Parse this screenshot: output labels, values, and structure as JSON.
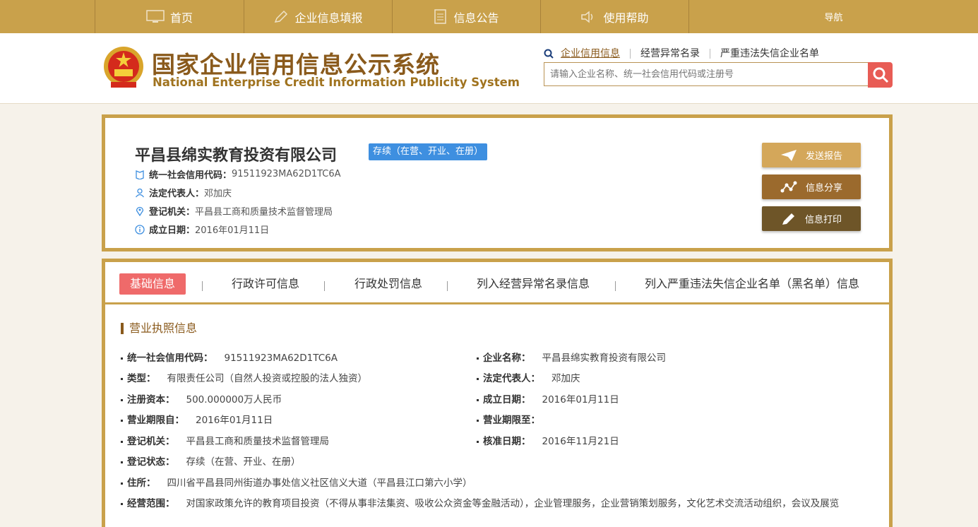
{
  "topnav": {
    "home": "首页",
    "fill": "企业信息填报",
    "notice": "信息公告",
    "help": "使用帮助",
    "guide": "导航"
  },
  "header": {
    "title_cn": "国家企业信用信息公示系统",
    "title_en": "National Enterprise Credit Information Publicity System",
    "search_links": [
      "企业信用信息",
      "经营异常名录",
      "严重违法失信企业名单"
    ],
    "search_placeholder": "请输入企业名称、统一社会信用代码或注册号"
  },
  "company": {
    "name": "平昌县绵实教育投资有限公司",
    "status": "存续（在营、开业、在册）",
    "credit_code_label": "统一社会信用代码：",
    "credit_code": "91511923MA62D1TC6A",
    "legal_rep_label": "法定代表人：",
    "legal_rep": "邓加庆",
    "reg_authority_label": "登记机关：",
    "reg_authority": "平昌县工商和质量技术监督管理局",
    "founded_label": "成立日期：",
    "founded": "2016年01月11日"
  },
  "actions": {
    "report": "发送报告",
    "share": "信息分享",
    "print": "信息打印"
  },
  "tabs": [
    "基础信息",
    "行政许可信息",
    "行政处罚信息",
    "列入经营异常名录信息",
    "列入严重违法失信企业名单（黑名单）信息"
  ],
  "section": {
    "title": "营业执照信息",
    "fields": [
      {
        "label": "统一社会信用代码：",
        "value": "91511923MA62D1TC6A"
      },
      {
        "label": "企业名称：",
        "value": "平昌县绵实教育投资有限公司"
      },
      {
        "label": "类型：",
        "value": "有限责任公司（自然人投资或控股的法人独资）"
      },
      {
        "label": "法定代表人：",
        "value": "邓加庆"
      },
      {
        "label": "注册资本：",
        "value": "500.000000万人民币"
      },
      {
        "label": "成立日期：",
        "value": "2016年01月11日"
      },
      {
        "label": "营业期限自：",
        "value": "2016年01月11日"
      },
      {
        "label": "营业期限至：",
        "value": ""
      },
      {
        "label": "登记机关：",
        "value": "平昌县工商和质量技术监督管理局"
      },
      {
        "label": "核准日期：",
        "value": "2016年11月21日"
      },
      {
        "label": "登记状态：",
        "value": "存续（在营、开业、在册）"
      },
      {
        "label": "住所：",
        "value": "四川省平昌县同州街道办事处信义社区信义大道（平昌县江口第六小学）"
      },
      {
        "label": "经营范围：",
        "value": "对国家政策允许的教育项目投资（不得从事非法集资、吸收公众资金等金融活动），企业管理服务，企业营销策划服务，文化艺术交流活动组织，会议及展览"
      }
    ]
  }
}
